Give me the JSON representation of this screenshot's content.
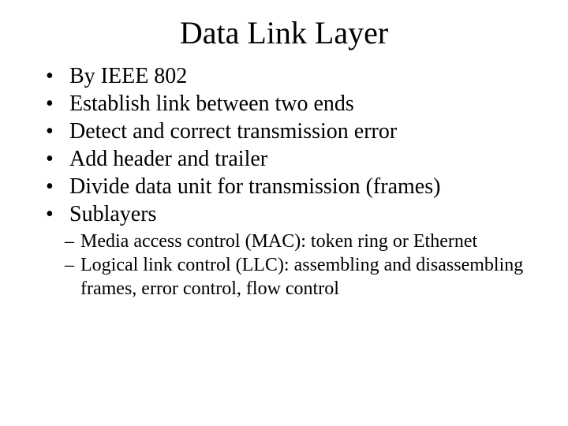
{
  "title": "Data Link Layer",
  "bullets": [
    "By IEEE 802",
    "Establish link between two ends",
    "Detect and correct transmission error",
    "Add header and trailer",
    "Divide data unit for transmission (frames)",
    "Sublayers"
  ],
  "sub_bullets": [
    "Media access control (MAC): token ring or Ethernet",
    "Logical link control (LLC): assembling and disassembling frames, error control, flow control"
  ]
}
